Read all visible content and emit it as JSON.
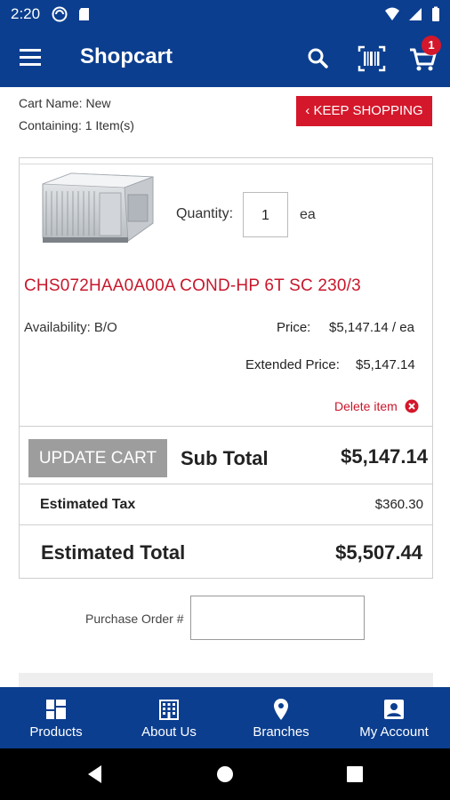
{
  "status_bar": {
    "time": "2:20"
  },
  "app_bar": {
    "title": "Shopcart",
    "cart_count": "1"
  },
  "cart": {
    "name_line": "Cart Name:  New",
    "containing_line": "Containing:  1 Item(s)",
    "keep_shopping_label": "‹ KEEP SHOPPING"
  },
  "item": {
    "quantity_label": "Quantity:",
    "quantity_value": "1",
    "quantity_unit": "ea",
    "name": "CHS072HAA0A00A COND-HP 6T SC 230/3",
    "availability": "Availability:  B/O",
    "price_label": "Price:",
    "price_value": "$5,147.14 / ea",
    "extended_label": "Extended Price:",
    "extended_value": "$5,147.14",
    "delete_label": "Delete item"
  },
  "totals": {
    "update_label": "UPDATE CART",
    "subtotal_label": "Sub Total",
    "subtotal_value": "$5,147.14",
    "tax_label": "Estimated Tax",
    "tax_value": "$360.30",
    "total_label": "Estimated Total",
    "total_value": "$5,507.44"
  },
  "purchase_order": {
    "label": "Purchase Order #",
    "value": ""
  },
  "bottom_nav": {
    "items": [
      {
        "label": "Products",
        "icon": "products-grid-icon"
      },
      {
        "label": "About Us",
        "icon": "building-icon"
      },
      {
        "label": "Branches",
        "icon": "location-pin-icon"
      },
      {
        "label": "My Account",
        "icon": "account-icon"
      }
    ]
  },
  "colors": {
    "primary": "#0b3e8f",
    "accent": "#d4172a",
    "update_gray": "#9d9d9d"
  }
}
